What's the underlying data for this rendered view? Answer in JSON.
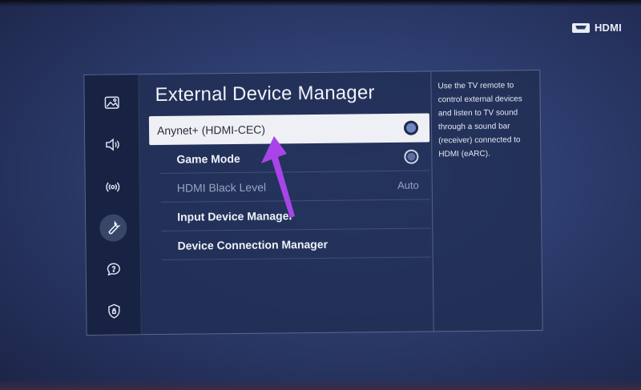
{
  "source": {
    "label": "HDMI",
    "icon": "hdmi-port-icon"
  },
  "sidebar": {
    "items": [
      {
        "icon": "picture-icon",
        "active": false
      },
      {
        "icon": "sound-icon",
        "active": false
      },
      {
        "icon": "broadcasting-icon",
        "active": false
      },
      {
        "icon": "wrench-icon",
        "active": true
      },
      {
        "icon": "support-icon",
        "active": false
      },
      {
        "icon": "privacy-shield-icon",
        "active": false
      }
    ]
  },
  "main": {
    "title": "External Device Manager",
    "menu": [
      {
        "label": "Anynet+ (HDMI-CEC)",
        "control": "toggle",
        "selected": true
      },
      {
        "label": "Game Mode",
        "control": "toggle",
        "selected": false
      },
      {
        "label": "HDMI Black Level",
        "value": "Auto",
        "dimmed": true
      },
      {
        "label": "Input Device Manager"
      },
      {
        "label": "Device Connection Manager"
      }
    ]
  },
  "help": {
    "text": "Use the TV remote to control external devices and listen to TV sound through a sound bar (receiver) connected to HDMI (eARC)."
  },
  "colors": {
    "background": "#2c3c6d",
    "annotation_arrow": "#a945e8",
    "selected_row": "#eef0f5"
  }
}
